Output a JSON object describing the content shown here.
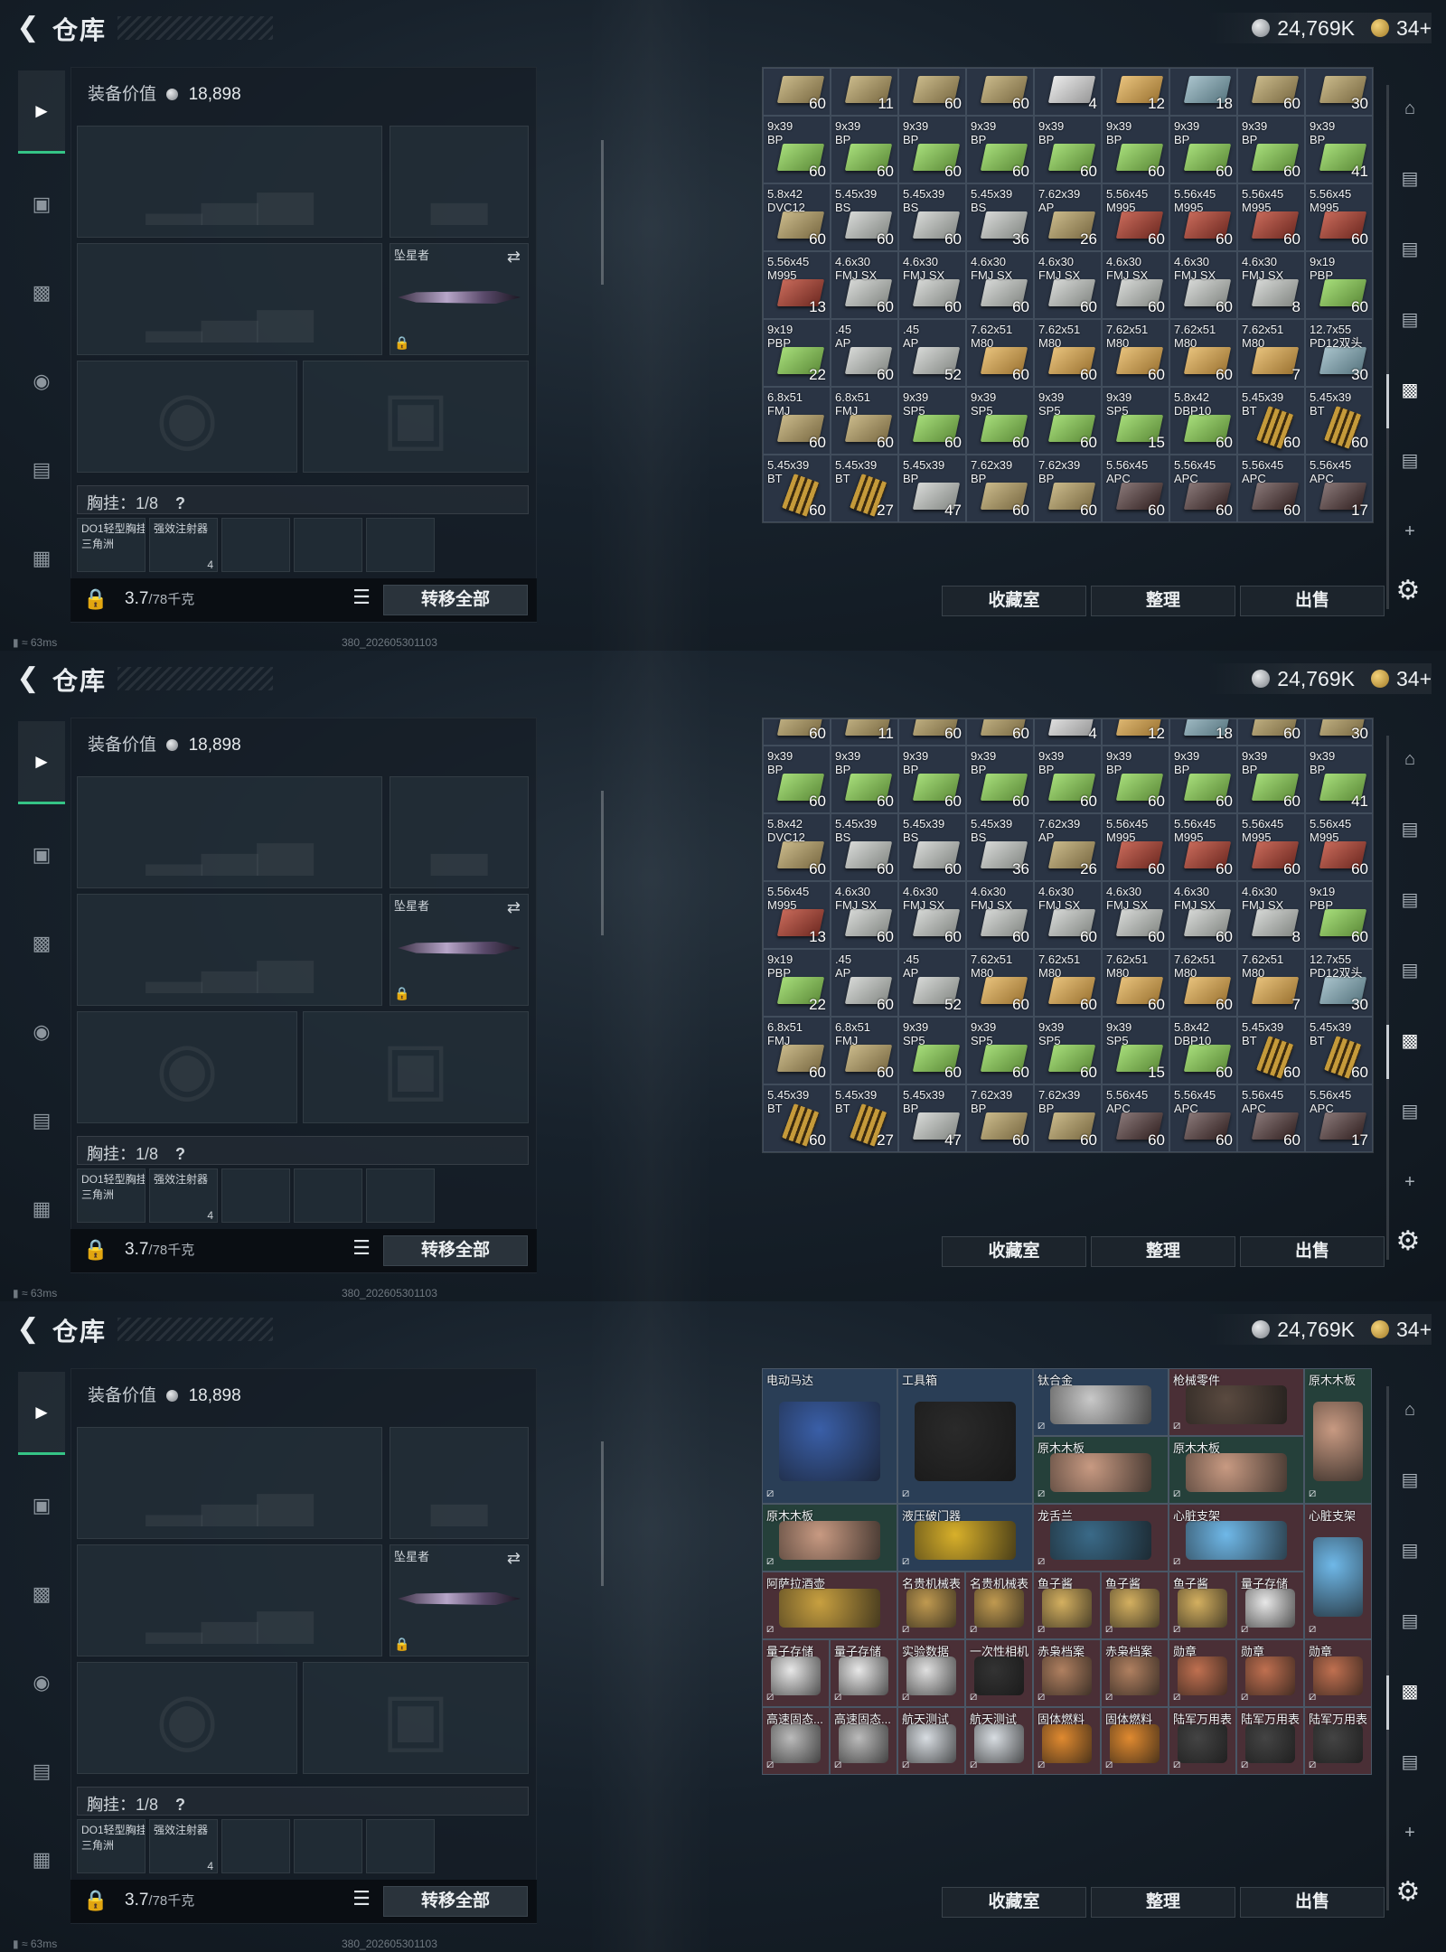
{
  "panels": [
    {
      "id": "p1",
      "variant": "ammo_scrolled"
    },
    {
      "id": "p2",
      "variant": "ammo"
    },
    {
      "id": "p3",
      "variant": "valuables"
    }
  ],
  "header": {
    "title": "仓库",
    "back_icon": "back-arrow-icon",
    "silver": "24,769K",
    "gold": "34+"
  },
  "equipment": {
    "value_label": "装备价值",
    "value": "18,898",
    "knife_label": "坠星者",
    "chest_label": "胸挂：1/8",
    "chest_help": "?",
    "mini_items": [
      "DO1轻型胸挂\n三角洲",
      "强效注射器"
    ],
    "mini_count": "4",
    "weight": "3.7",
    "weight_unit": "/78千克",
    "transfer_all": "转移全部"
  },
  "status": {
    "ping": "63ms",
    "build": "380_202605301103"
  },
  "actions": {
    "vault": "收藏室",
    "sort": "整理",
    "sell": "出售"
  },
  "ammo_top_partial": [
    {
      "n": "",
      "c": "60",
      "col": "khaki"
    },
    {
      "n": "",
      "c": "11",
      "col": "khaki"
    },
    {
      "n": "",
      "c": "60",
      "col": "khaki"
    },
    {
      "n": "",
      "c": "60",
      "col": "khaki"
    },
    {
      "n": "",
      "c": "4",
      "col": "silver"
    },
    {
      "n": "",
      "c": "12",
      "col": "yellow"
    },
    {
      "n": "",
      "c": "18",
      "col": "blue"
    },
    {
      "n": "",
      "c": "60",
      "col": "khaki"
    },
    {
      "n": "",
      "c": "30",
      "col": "khaki"
    }
  ],
  "ammo_rows": [
    [
      {
        "n": "9x39\nBP",
        "c": "60",
        "col": "green"
      },
      {
        "n": "9x39\nBP",
        "c": "60",
        "col": "green"
      },
      {
        "n": "9x39\nBP",
        "c": "60",
        "col": "green"
      },
      {
        "n": "9x39\nBP",
        "c": "60",
        "col": "green"
      },
      {
        "n": "9x39\nBP",
        "c": "60",
        "col": "green"
      },
      {
        "n": "9x39\nBP",
        "c": "60",
        "col": "green"
      },
      {
        "n": "9x39\nBP",
        "c": "60",
        "col": "green"
      },
      {
        "n": "9x39\nBP",
        "c": "60",
        "col": "green"
      },
      {
        "n": "9x39\nBP",
        "c": "41",
        "col": "green"
      }
    ],
    [
      {
        "n": "5.8x42\nDVC12",
        "c": "60",
        "col": "khaki"
      },
      {
        "n": "5.45x39\nBS",
        "c": "60",
        "col": "gray"
      },
      {
        "n": "5.45x39\nBS",
        "c": "60",
        "col": "gray"
      },
      {
        "n": "5.45x39\nBS",
        "c": "36",
        "col": "gray"
      },
      {
        "n": "7.62x39\nAP",
        "c": "26",
        "col": "khaki"
      },
      {
        "n": "5.56x45\nM995",
        "c": "60",
        "col": "red"
      },
      {
        "n": "5.56x45\nM995",
        "c": "60",
        "col": "red"
      },
      {
        "n": "5.56x45\nM995",
        "c": "60",
        "col": "red"
      },
      {
        "n": "5.56x45\nM995",
        "c": "60",
        "col": "red"
      }
    ],
    [
      {
        "n": "5.56x45\nM995",
        "c": "13",
        "col": "red"
      },
      {
        "n": "4.6x30\nFMJ SX",
        "c": "60",
        "col": "gray"
      },
      {
        "n": "4.6x30\nFMJ SX",
        "c": "60",
        "col": "gray"
      },
      {
        "n": "4.6x30\nFMJ SX",
        "c": "60",
        "col": "gray"
      },
      {
        "n": "4.6x30\nFMJ SX",
        "c": "60",
        "col": "gray"
      },
      {
        "n": "4.6x30\nFMJ SX",
        "c": "60",
        "col": "gray"
      },
      {
        "n": "4.6x30\nFMJ SX",
        "c": "60",
        "col": "gray"
      },
      {
        "n": "4.6x30\nFMJ SX",
        "c": "8",
        "col": "gray"
      },
      {
        "n": "9x19\nPBP",
        "c": "60",
        "col": "green"
      }
    ],
    [
      {
        "n": "9x19\nPBP",
        "c": "22",
        "col": "green"
      },
      {
        "n": ".45\nAP",
        "c": "60",
        "col": "gray"
      },
      {
        "n": ".45\nAP",
        "c": "52",
        "col": "gray"
      },
      {
        "n": "7.62x51\nM80",
        "c": "60",
        "col": "yellow"
      },
      {
        "n": "7.62x51\nM80",
        "c": "60",
        "col": "yellow"
      },
      {
        "n": "7.62x51\nM80",
        "c": "60",
        "col": "yellow"
      },
      {
        "n": "7.62x51\nM80",
        "c": "60",
        "col": "yellow"
      },
      {
        "n": "7.62x51\nM80",
        "c": "7",
        "col": "yellow"
      },
      {
        "n": "12.7x55\nPD12双头",
        "c": "30",
        "col": "blue"
      }
    ],
    [
      {
        "n": "6.8x51\nFMJ",
        "c": "60",
        "col": "khaki"
      },
      {
        "n": "6.8x51\nFMJ",
        "c": "60",
        "col": "khaki"
      },
      {
        "n": "9x39\nSP5",
        "c": "60",
        "col": "green"
      },
      {
        "n": "9x39\nSP5",
        "c": "60",
        "col": "green"
      },
      {
        "n": "9x39\nSP5",
        "c": "60",
        "col": "green"
      },
      {
        "n": "9x39\nSP5",
        "c": "15",
        "col": "green"
      },
      {
        "n": "5.8x42\nDBP10",
        "c": "60",
        "col": "green"
      },
      {
        "n": "5.45x39\nBT",
        "c": "60",
        "col": "bullets"
      },
      {
        "n": "5.45x39\nBT",
        "c": "60",
        "col": "bullets"
      }
    ],
    [
      {
        "n": "5.45x39\nBT",
        "c": "60",
        "col": "bullets"
      },
      {
        "n": "5.45x39\nBT",
        "c": "27",
        "col": "bullets"
      },
      {
        "n": "5.45x39\nBP",
        "c": "47",
        "col": "gray"
      },
      {
        "n": "7.62x39\nBP",
        "c": "60",
        "col": "khaki"
      },
      {
        "n": "7.62x39\nBP",
        "c": "60",
        "col": "khaki"
      },
      {
        "n": "5.56x45\nAPC",
        "c": "60",
        "col": "dark"
      },
      {
        "n": "5.56x45\nAPC",
        "c": "60",
        "col": "dark"
      },
      {
        "n": "5.56x45\nAPC",
        "c": "60",
        "col": "dark"
      },
      {
        "n": "5.56x45\nAPC",
        "c": "17",
        "col": "dark"
      }
    ]
  ],
  "valuables": [
    {
      "n": "电动马达",
      "bg": "blue",
      "pc": "#3a5fa8",
      "x": 0,
      "y": 0,
      "w": 2,
      "h": 2
    },
    {
      "n": "工具箱",
      "bg": "blue",
      "pc": "#2a2a2a",
      "x": 2,
      "y": 0,
      "w": 2,
      "h": 2
    },
    {
      "n": "钛合金",
      "bg": "blue",
      "pc": "#c9c9c9",
      "x": 4,
      "y": 0,
      "w": 2,
      "h": 1
    },
    {
      "n": "枪械零件",
      "bg": "red",
      "pc": "#5a4a40",
      "x": 6,
      "y": 0,
      "w": 2,
      "h": 1
    },
    {
      "n": "原木木板",
      "bg": "green",
      "pc": "#c89a82",
      "x": 8,
      "y": 0,
      "w": 1,
      "h": 2
    },
    {
      "n": "原木木板",
      "bg": "green",
      "pc": "#c89a82",
      "x": 4,
      "y": 1,
      "w": 2,
      "h": 1
    },
    {
      "n": "原木木板",
      "bg": "green",
      "pc": "#c89a82",
      "x": 6,
      "y": 1,
      "w": 2,
      "h": 1
    },
    {
      "n": "原木木板",
      "bg": "green",
      "pc": "#c89a82",
      "x": 0,
      "y": 2,
      "w": 2,
      "h": 1
    },
    {
      "n": "液压破门器",
      "bg": "blue",
      "pc": "#d8b02a",
      "x": 2,
      "y": 2,
      "w": 2,
      "h": 1
    },
    {
      "n": "龙舌兰",
      "bg": "red",
      "pc": "#3a6a88",
      "x": 4,
      "y": 2,
      "w": 2,
      "h": 1
    },
    {
      "n": "心脏支架",
      "bg": "red",
      "pc": "#6fb8e8",
      "x": 6,
      "y": 2,
      "w": 2,
      "h": 1
    },
    {
      "n": "心脏支架",
      "bg": "red",
      "pc": "#6fb8e8",
      "x": 8,
      "y": 2,
      "w": 1,
      "h": 2
    },
    {
      "n": "阿萨拉酒壶",
      "bg": "red",
      "pc": "#c8a040",
      "x": 0,
      "y": 3,
      "w": 2,
      "h": 1
    },
    {
      "n": "名贵机械表",
      "bg": "red",
      "pc": "#c09a50",
      "x": 2,
      "y": 3,
      "w": 1,
      "h": 1
    },
    {
      "n": "名贵机械表",
      "bg": "red",
      "pc": "#c09a50",
      "x": 3,
      "y": 3,
      "w": 1,
      "h": 1
    },
    {
      "n": "鱼子酱",
      "bg": "red",
      "pc": "#d4b060",
      "x": 4,
      "y": 3,
      "w": 1,
      "h": 1
    },
    {
      "n": "鱼子酱",
      "bg": "red",
      "pc": "#d4b060",
      "x": 5,
      "y": 3,
      "w": 1,
      "h": 1
    },
    {
      "n": "鱼子酱",
      "bg": "red",
      "pc": "#d4b060",
      "x": 6,
      "y": 3,
      "w": 1,
      "h": 1
    },
    {
      "n": "量子存储",
      "bg": "red",
      "pc": "#e8e8e8",
      "x": 7,
      "y": 3,
      "w": 1,
      "h": 1
    },
    {
      "n": "量子存储",
      "bg": "red",
      "pc": "#e8e8e8",
      "x": 0,
      "y": 4,
      "w": 1,
      "h": 1
    },
    {
      "n": "量子存储",
      "bg": "red",
      "pc": "#e8e8e8",
      "x": 1,
      "y": 4,
      "w": 1,
      "h": 1
    },
    {
      "n": "实验数据",
      "bg": "red",
      "pc": "#e0e0e0",
      "x": 2,
      "y": 4,
      "w": 1,
      "h": 1
    },
    {
      "n": "一次性相机",
      "bg": "red",
      "pc": "#333",
      "x": 3,
      "y": 4,
      "w": 1,
      "h": 1
    },
    {
      "n": "赤枭档案",
      "bg": "red",
      "pc": "#b08060",
      "x": 4,
      "y": 4,
      "w": 1,
      "h": 1
    },
    {
      "n": "赤枭档案",
      "bg": "red",
      "pc": "#b08060",
      "x": 5,
      "y": 4,
      "w": 1,
      "h": 1
    },
    {
      "n": "勋章",
      "bg": "red",
      "pc": "#c07050",
      "x": 6,
      "y": 4,
      "w": 1,
      "h": 1
    },
    {
      "n": "勋章",
      "bg": "red",
      "pc": "#c07050",
      "x": 7,
      "y": 4,
      "w": 1,
      "h": 1
    },
    {
      "n": "勋章",
      "bg": "red",
      "pc": "#c07050",
      "x": 8,
      "y": 4,
      "w": 1,
      "h": 1
    },
    {
      "n": "高速固态...",
      "bg": "red",
      "pc": "#bbb",
      "x": 0,
      "y": 5,
      "w": 1,
      "h": 1
    },
    {
      "n": "高速固态...",
      "bg": "red",
      "pc": "#bbb",
      "x": 1,
      "y": 5,
      "w": 1,
      "h": 1
    },
    {
      "n": "航天测试",
      "bg": "red",
      "pc": "#d8dde2",
      "x": 2,
      "y": 5,
      "w": 1,
      "h": 1
    },
    {
      "n": "航天测试",
      "bg": "red",
      "pc": "#d8dde2",
      "x": 3,
      "y": 5,
      "w": 1,
      "h": 1
    },
    {
      "n": "固体燃料",
      "bg": "red",
      "pc": "#e08a30",
      "x": 4,
      "y": 5,
      "w": 1,
      "h": 1
    },
    {
      "n": "固体燃料",
      "bg": "red",
      "pc": "#e08a30",
      "x": 5,
      "y": 5,
      "w": 1,
      "h": 1
    },
    {
      "n": "陆军万用表",
      "bg": "red",
      "pc": "#444",
      "x": 6,
      "y": 5,
      "w": 1,
      "h": 1
    },
    {
      "n": "陆军万用表",
      "bg": "red",
      "pc": "#444",
      "x": 7,
      "y": 5,
      "w": 1,
      "h": 1
    },
    {
      "n": "陆军万用表",
      "bg": "red",
      "pc": "#444",
      "x": 8,
      "y": 5,
      "w": 1,
      "h": 1
    }
  ]
}
